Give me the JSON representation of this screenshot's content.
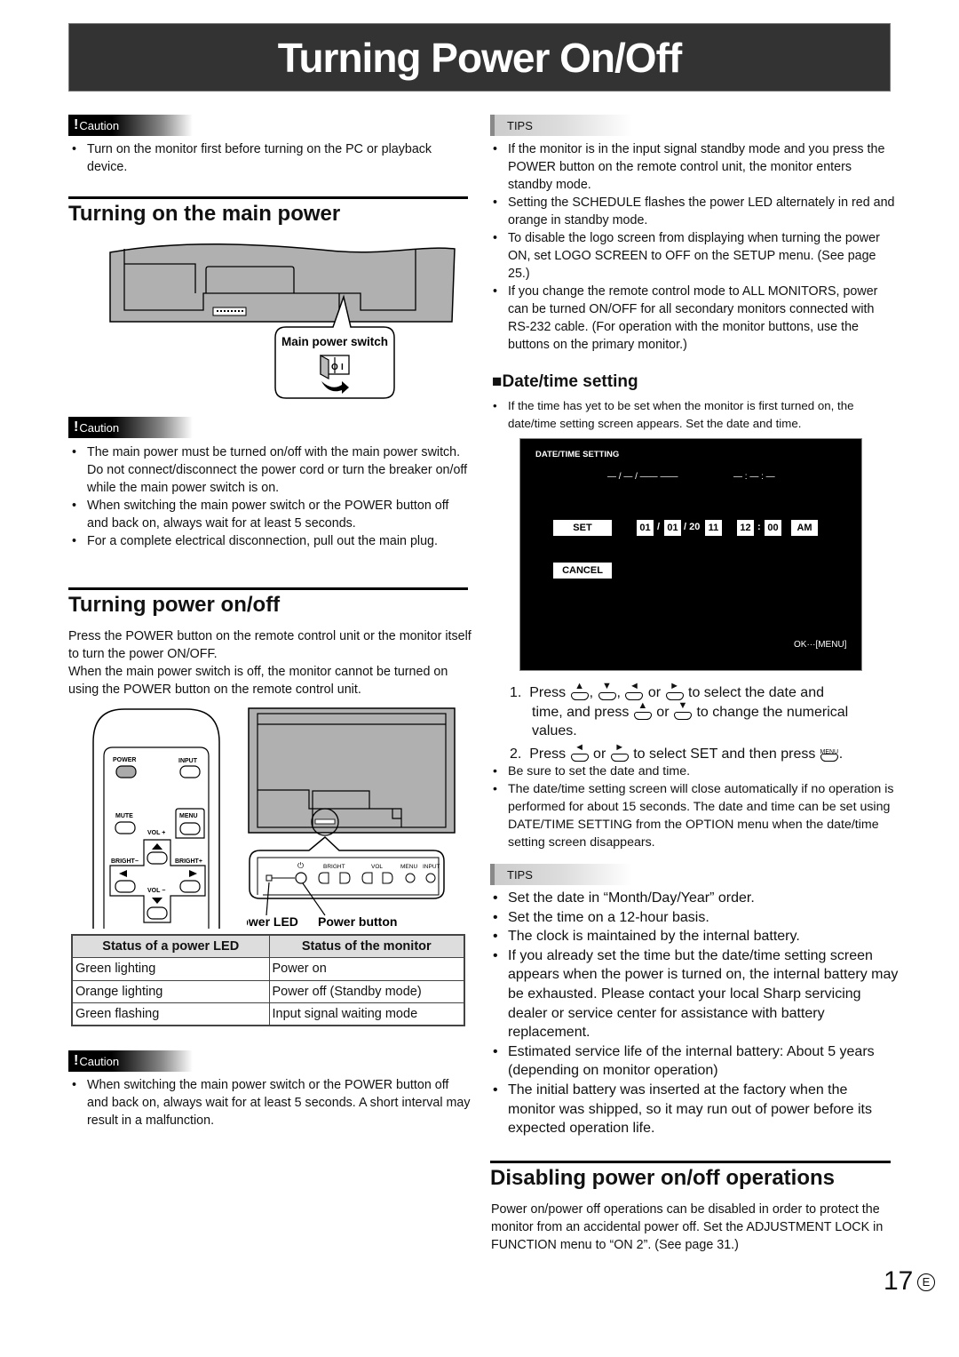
{
  "page_title": "Turning Power On/Off",
  "caution_label": "Caution",
  "tips_label": "TIPS",
  "left": {
    "caution1": [
      "Turn on the monitor first before turning on the PC or playback device."
    ],
    "main_power": {
      "heading": "Turning on the main power",
      "callout_label": "Main power switch",
      "switch_off_symbol": "O",
      "switch_on_symbol": "I"
    },
    "caution2": [
      "The main power must be turned on/off with the main power switch. Do not connect/disconnect the power cord or turn the breaker on/off while the main power switch is on.",
      "When switching the main power switch or the POWER button off and back on, always wait for at least 5 seconds.",
      "For a complete electrical disconnection, pull out the main plug."
    ],
    "power_onoff": {
      "heading": "Turning power on/off",
      "paragraph1": "Press the POWER button on the remote control unit or the monitor itself to turn the power ON/OFF.",
      "paragraph2": "When the main power switch is off, the monitor cannot be turned on using the POWER button on the remote control unit."
    },
    "remote": {
      "power": "POWER",
      "input": "INPUT",
      "mute": "MUTE",
      "menu": "MENU",
      "vol_plus": "VOL +",
      "vol_minus": "VOL −",
      "bright_minus": "BRIGHT−",
      "bright_plus": "BRIGHT+"
    },
    "monitor_panel": {
      "power_symbol": "⏻",
      "bright": "BRIGHT",
      "vol": "VOL",
      "menu": "MENU",
      "input": "INPUT",
      "label_led": "Power LED",
      "label_button": "Power button"
    },
    "status_table": {
      "headers": [
        "Status of a power LED",
        "Status of the monitor"
      ],
      "rows": [
        [
          "Green lighting",
          "Power on"
        ],
        [
          "Orange lighting",
          "Power off (Standby mode)"
        ],
        [
          "Green flashing",
          "Input signal waiting mode"
        ]
      ]
    },
    "caution3": [
      "When switching the main power switch or the POWER button off and back on, always wait for at least 5 seconds. A short interval may result in a malfunction."
    ]
  },
  "right": {
    "tips1": [
      "If the monitor is in the input signal standby mode and you press the POWER button on the remote control unit, the monitor enters standby mode.",
      "Setting the SCHEDULE flashes the power LED alternately in red and orange in standby mode.",
      "To disable the logo screen from displaying when turning the power ON, set LOGO SCREEN to OFF on the SETUP menu. (See page 25.)",
      "If you change the remote control mode to ALL MONITORS, power can be turned ON/OFF for all secondary monitors connected with RS-232 cable. (For operation with the monitor buttons, use the buttons on the primary monitor.)"
    ],
    "datetime": {
      "heading": "■Date/time setting",
      "intro": [
        "If the time has yet to be set when the monitor is first turned on, the date/time setting screen appears. Set the date and time."
      ],
      "osd": {
        "title": "DATE/TIME SETTING",
        "placeholder_date": "— / — / ——   ——",
        "placeholder_time": "— : — : —",
        "set": "SET",
        "cancel": "CANCEL",
        "month": "01",
        "day": "01",
        "year_prefix": "/ 20",
        "year": "11",
        "hour": "12",
        "minute": "00",
        "ampm": "AM",
        "sep_slash": "/",
        "sep_colon": ":",
        "ok_hint": "OK···[MENU]"
      },
      "step1_num": "1.",
      "step1_a": "Press",
      "step1_b": ",",
      "step1_c": ",",
      "step1_d": "or",
      "step1_e": "to select the date and",
      "step1_f": "time, and press",
      "step1_g": "or",
      "step1_h": "to change the numerical",
      "step1_i": "values.",
      "step2_num": "2.",
      "step2_a": "Press",
      "step2_b": "or",
      "step2_c": "to select SET and then press",
      "step2_d": ".",
      "menu_key": "MENU",
      "notes": [
        "Be sure to set the date and time.",
        "The date/time setting screen will close automatically if no operation is performed for about 15 seconds. The date and time can be set using DATE/TIME SETTING from the OPTION menu when the date/time setting screen disappears."
      ]
    },
    "tips2": [
      "Set the date in “Month/Day/Year” order.",
      "Set the time on a 12-hour basis.",
      "The clock is maintained by the internal battery.",
      "If you already set the time but the date/time setting screen appears when the power is turned on, the internal battery may be exhausted. Please contact your local Sharp servicing dealer or service center for assistance with battery replacement.",
      "Estimated service life of the internal battery: About 5 years (depending on monitor operation)",
      "The initial battery was inserted at the factory when the monitor was shipped, so it may run out of power before its expected operation life."
    ],
    "disable": {
      "heading": "Disabling power on/off operations",
      "paragraph": "Power on/power off operations can be disabled in order to protect the monitor from an accidental power off. Set the ADJUSTMENT LOCK in FUNCTION menu to “ON 2”. (See page 31.)"
    }
  },
  "footer": {
    "page_number": "17",
    "language_mark": "E"
  }
}
